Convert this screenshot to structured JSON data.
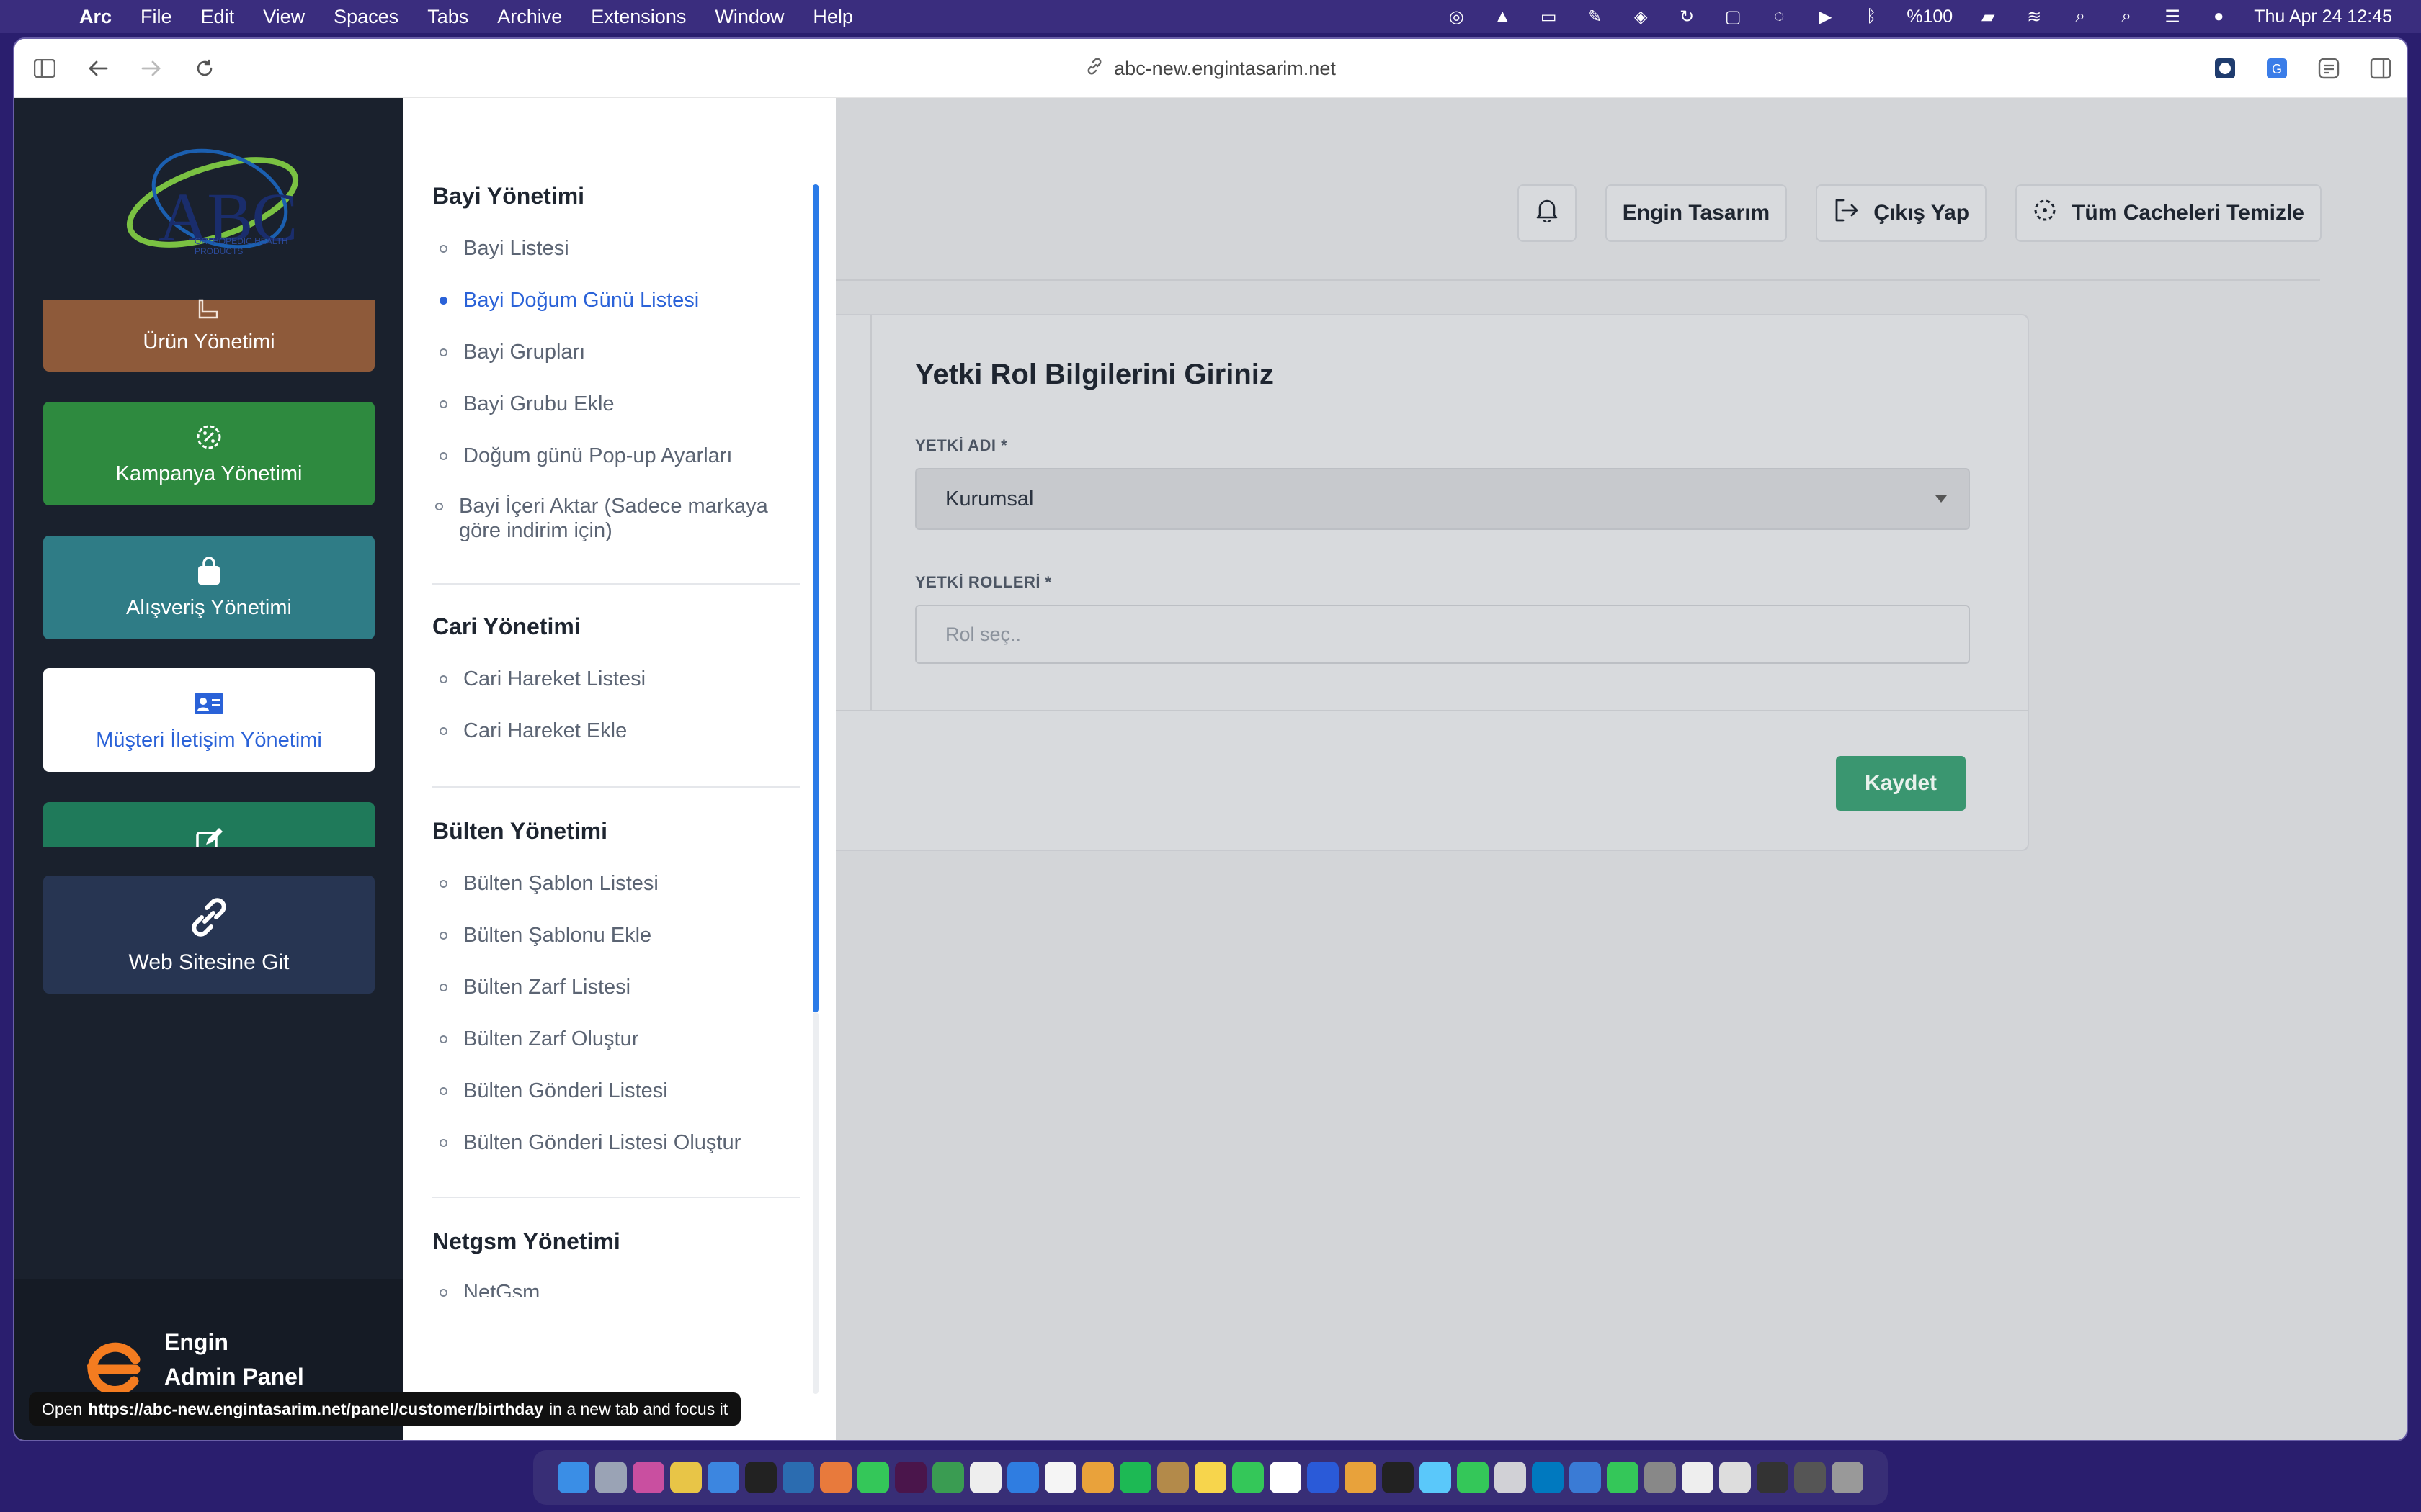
{
  "menubar": {
    "app_name": "Arc",
    "items": [
      "File",
      "Edit",
      "View",
      "Spaces",
      "Tabs",
      "Archive",
      "Extensions",
      "Window",
      "Help"
    ],
    "battery": "%100",
    "datetime": "Thu Apr 24  12:45"
  },
  "browser": {
    "url": "abc-new.engintasarim.net"
  },
  "logo": {
    "text": "ABC",
    "tagline": "ORTHOPEDIC HEALTH PRODUCTS"
  },
  "sidebar": {
    "buttons": [
      {
        "label": "Ürün Yönetimi",
        "icon": "boot-icon"
      },
      {
        "label": "Kampanya Yönetimi",
        "icon": "badge-percent-icon"
      },
      {
        "label": "Alışveriş Yönetimi",
        "icon": "shopping-bag-icon"
      },
      {
        "label": "Müşteri İletişim Yönetimi",
        "icon": "contact-card-icon"
      },
      {
        "label": "",
        "icon": "edit-icon"
      },
      {
        "label": "Web Sitesine Git",
        "icon": "link-icon"
      }
    ],
    "footer": {
      "line1": "Engin",
      "line2": "Admin Panel"
    }
  },
  "submenu": {
    "sections": [
      {
        "title": "Bayi Yönetimi",
        "items": [
          "Bayi Listesi",
          "Bayi Doğum Günü Listesi",
          "Bayi Grupları",
          "Bayi Grubu Ekle",
          "Doğum günü Pop-up Ayarları",
          "Bayi İçeri Aktar (Sadece markaya göre indirim için)"
        ],
        "active_index": 1
      },
      {
        "title": "Cari Yönetimi",
        "items": [
          "Cari Hareket Listesi",
          "Cari Hareket Ekle"
        ]
      },
      {
        "title": "Bülten Yönetimi",
        "items": [
          "Bülten Şablon Listesi",
          "Bülten Şablonu Ekle",
          "Bülten Zarf Listesi",
          "Bülten Zarf Oluştur",
          "Bülten Gönderi Listesi",
          "Bülten Gönderi Listesi Oluştur"
        ]
      },
      {
        "title": "Netgsm Yönetimi",
        "items": [
          "NetGsm"
        ]
      }
    ]
  },
  "header": {
    "user_name": "Engin Tasarım",
    "logout_label": "Çıkış Yap",
    "clear_cache_label": "Tüm Cacheleri Temizle"
  },
  "form": {
    "title": "Yetki Rol Bilgilerini Giriniz",
    "role_name_label": "YETKİ ADI *",
    "role_name_value": "Kurumsal",
    "roles_label": "YETKİ ROLLERİ *",
    "roles_placeholder": "Rol seç..",
    "save_label": "Kaydet"
  },
  "status_tip": {
    "prefix": "Open",
    "url": "https://abc-new.engintasarim.net/panel/customer/birthday",
    "suffix": "in a new tab and focus it"
  },
  "colors": {
    "accent": "#2a62d8",
    "sidebar_bg": "#1a212d",
    "save_button": "#3a9670"
  }
}
